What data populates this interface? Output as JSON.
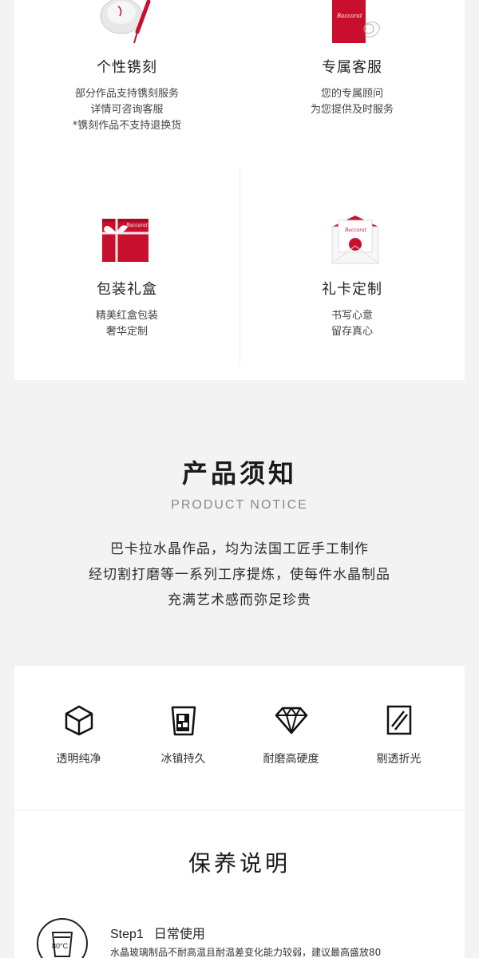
{
  "services": [
    {
      "title": "个性镌刻",
      "desc": [
        "部分作品支持镌刻服务",
        "详情可咨询客服",
        "*镌刻作品不支持退换货"
      ],
      "icon": "engraving-glass-icon"
    },
    {
      "title": "专属客服",
      "desc": [
        "您的专属顾问",
        "为您提供及时服务"
      ],
      "icon": "service-card-icon"
    },
    {
      "title": "包装礼盒",
      "desc": [
        "精美红盒包装",
        "奢华定制"
      ],
      "icon": "gift-box-icon"
    },
    {
      "title": "礼卡定制",
      "desc": [
        "书写心意",
        "留存真心"
      ],
      "icon": "gift-card-envelope-icon"
    }
  ],
  "notice": {
    "title": "产品须知",
    "subtitle": "PRODUCT NOTICE",
    "lines": [
      "巴卡拉水晶作品，均为法国工匠手工制作",
      "经切割打磨等一系列工序提炼，使每件水晶制品",
      "充满艺术感而弥足珍贵"
    ]
  },
  "features": [
    {
      "label": "透明纯净",
      "icon": "cube-icon"
    },
    {
      "label": "冰镇持久",
      "icon": "ice-glass-icon"
    },
    {
      "label": "耐磨高硬度",
      "icon": "diamond-icon"
    },
    {
      "label": "剔透折光",
      "icon": "refraction-icon"
    }
  ],
  "care": {
    "title": "保养说明",
    "step": {
      "num": "Step1",
      "title": "日常使用",
      "text": "水晶玻璃制品不耐高温且耐温差变化能力较弱，建议最高盛放80",
      "icon_label": "80°C"
    }
  },
  "colors": {
    "brand_red": "#c8102e",
    "background": "#f3f3f3"
  }
}
